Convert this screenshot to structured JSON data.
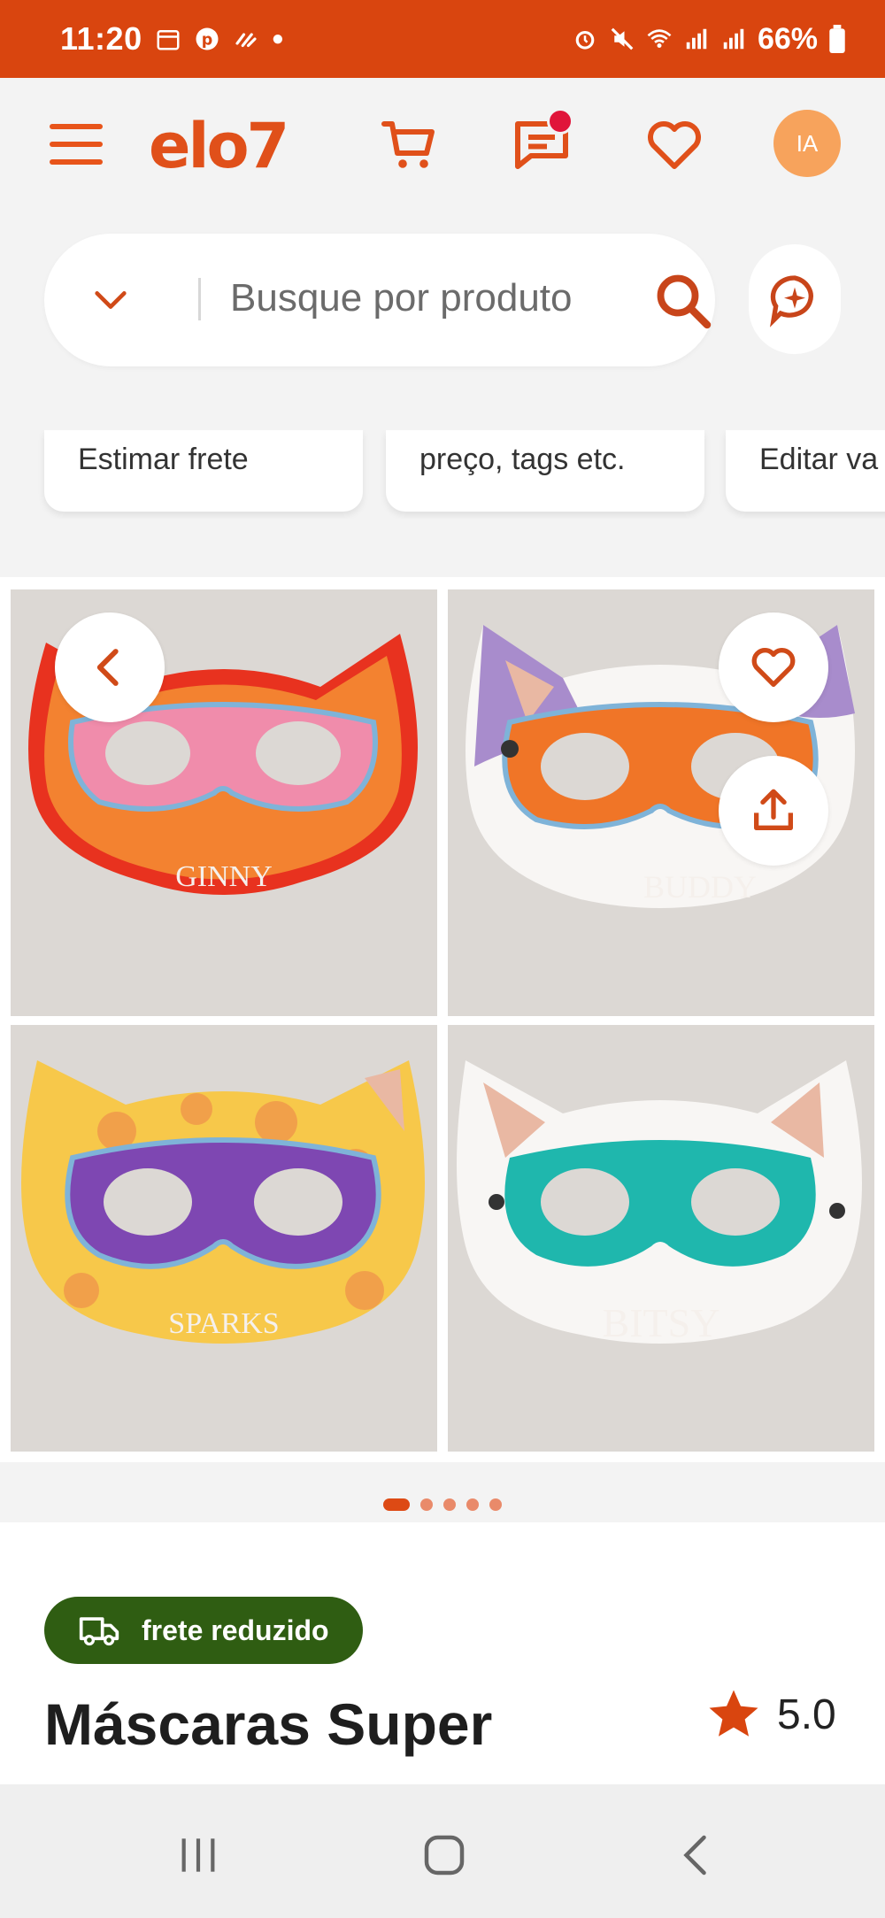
{
  "status_bar": {
    "time": "11:20",
    "battery": "66%"
  },
  "header": {
    "logo": "elo7",
    "avatar_initials": "IA",
    "messages_has_notification": true
  },
  "search": {
    "placeholder": "Busque por produto"
  },
  "chips": [
    {
      "label": "Estimar frete"
    },
    {
      "label": "preço, tags etc."
    },
    {
      "label": "Editar va"
    }
  ],
  "gallery": {
    "images": [
      {
        "label": "GINNY",
        "mask_color": "#f08cab",
        "face_color": "#f38230",
        "accent": "#e8321f"
      },
      {
        "label": "BUDDY",
        "mask_color": "#f07527",
        "face_color": "#ffffff",
        "accent": "#a88ccc"
      },
      {
        "label": "SPARKS",
        "mask_color": "#7e47b2",
        "face_color": "#f7c84a",
        "accent": "#f1a04a"
      },
      {
        "label": "BITSY",
        "mask_color": "#1fb7ad",
        "face_color": "#ffffff",
        "accent": "#e9b8a3"
      }
    ],
    "page_count": 5,
    "current_page": 1
  },
  "product": {
    "shipping_badge": "frete reduzido",
    "title": "Máscaras Super",
    "rating": "5.0"
  },
  "colors": {
    "brand": "#e0501a",
    "status_bar": "#d9450f",
    "badge_green": "#2f5d12"
  }
}
